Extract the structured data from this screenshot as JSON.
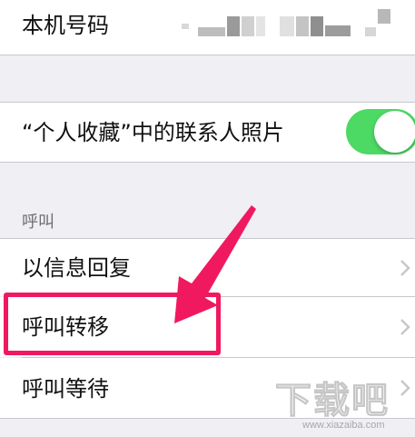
{
  "settings": {
    "my_number_label": "本机号码",
    "favorites_photos_label": "“个人收藏”中的联系人照片",
    "favorites_photos_enabled": true,
    "calls_section_header": "呼叫",
    "respond_with_text_label": "以信息回复",
    "call_forwarding_label": "呼叫转移",
    "call_waiting_label": "呼叫等待"
  },
  "annotation": {
    "highlight_color": "#f0195f",
    "highlighted_item": "呼叫转移"
  },
  "watermark": {
    "main_text": "下载吧",
    "sub_text": "www.xiazaiba.com"
  },
  "colors": {
    "toggle_on": "#4cd964",
    "background": "#efeff4",
    "separator": "#c8c7cc"
  }
}
